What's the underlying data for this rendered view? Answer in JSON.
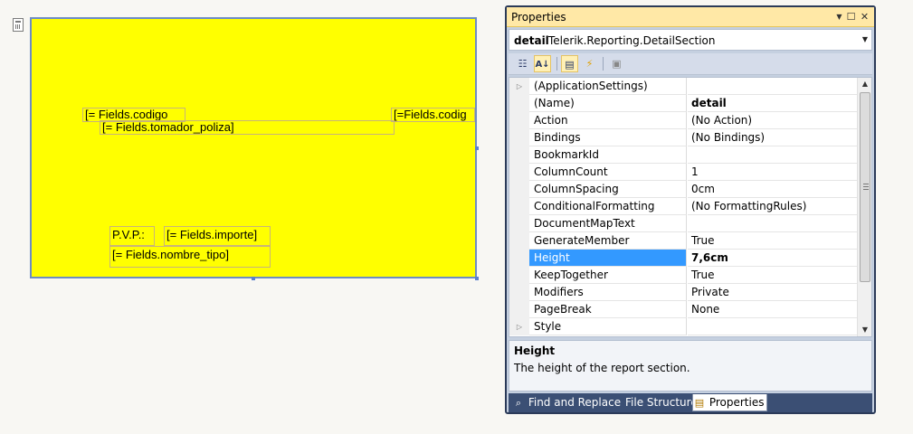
{
  "designer": {
    "section_icon": "report-section-icon",
    "textboxes": {
      "codigo_left": "[= Fields.codigo",
      "codigo_right": "[=Fields.codig",
      "tomador": "[= Fields.tomador_poliza]",
      "pvp": "P.V.P.:",
      "importe": "[= Fields.importe]",
      "nombre_tipo": "[= Fields.nombre_tipo]"
    }
  },
  "properties": {
    "title": "Properties",
    "object": {
      "name": "detail",
      "type": "Telerik.Reporting.DetailSection"
    },
    "rows": [
      {
        "name": "(ApplicationSettings)",
        "value": "",
        "expandable": true
      },
      {
        "name": "(Name)",
        "value": "detail"
      },
      {
        "name": "Action",
        "value": "(No Action)"
      },
      {
        "name": "Bindings",
        "value": "(No Bindings)"
      },
      {
        "name": "BookmarkId",
        "value": ""
      },
      {
        "name": "ColumnCount",
        "value": "1"
      },
      {
        "name": "ColumnSpacing",
        "value": "0cm"
      },
      {
        "name": "ConditionalFormatting",
        "value": "(No FormattingRules)"
      },
      {
        "name": "DocumentMapText",
        "value": ""
      },
      {
        "name": "GenerateMember",
        "value": "True"
      },
      {
        "name": "Height",
        "value": "7,6cm"
      },
      {
        "name": "KeepTogether",
        "value": "True"
      },
      {
        "name": "Modifiers",
        "value": "Private"
      },
      {
        "name": "PageBreak",
        "value": "None"
      },
      {
        "name": "Style",
        "value": "",
        "expandable": true
      }
    ],
    "selected_property": "Height",
    "description": {
      "title": "Height",
      "text": "The height of the report section."
    },
    "tabs": [
      {
        "label": "Find and Replace",
        "icon": "binoculars-icon"
      },
      {
        "label": "File Structure",
        "icon": ""
      },
      {
        "label": "Properties",
        "icon": "properties-icon"
      }
    ],
    "active_tab": "Properties"
  },
  "colors": {
    "section_background": "#ffff00",
    "selection": "#3399ff",
    "title_bar": "#ffe8a6"
  }
}
